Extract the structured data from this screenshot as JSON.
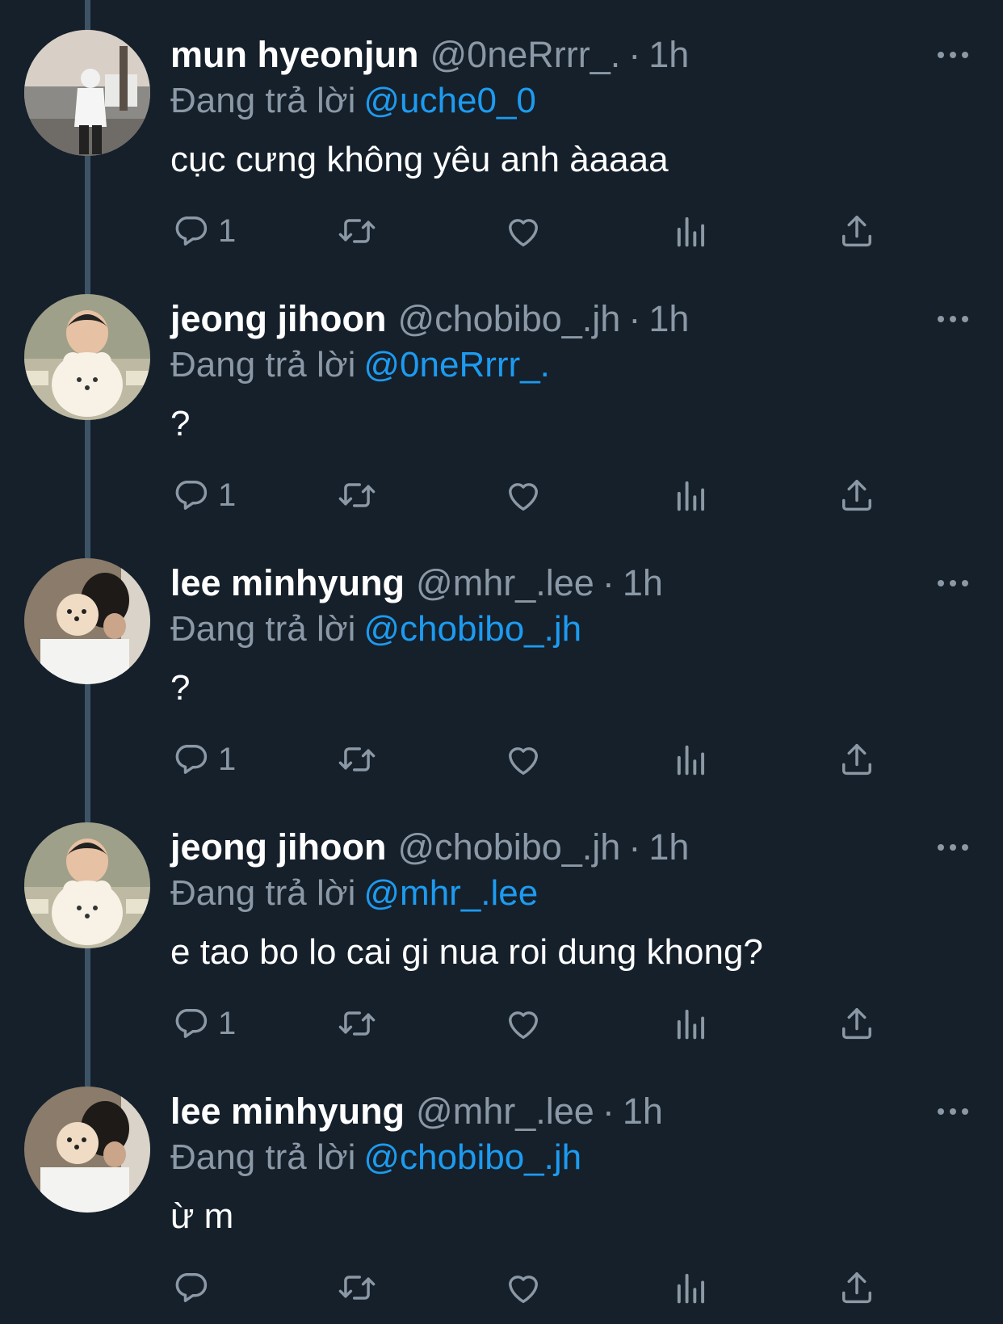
{
  "colors": {
    "background": "#15202b",
    "primary_text": "#ffffff",
    "secondary_text": "#8b98a5",
    "link": "#1d9bf0",
    "thread_line": "#3d5466"
  },
  "icons": {
    "reply": "reply-icon",
    "retweet": "retweet-icon",
    "like": "like-icon",
    "views": "views-icon",
    "share": "share-icon",
    "more": "more-icon"
  },
  "reply_prefix": "Đang trả lời",
  "tweets": [
    {
      "name": "mun hyeonjun",
      "handle": "@0neRrrr_.",
      "time": "1h",
      "reply_to": "@uche0_0",
      "text": "cục cưng không yêu anh àaaaa",
      "reply_count": "1"
    },
    {
      "name": "jeong jihoon",
      "handle": "@chobibo_.jh",
      "time": "1h",
      "reply_to": "@0neRrrr_.",
      "text": "?",
      "reply_count": "1"
    },
    {
      "name": "lee minhyung",
      "handle": "@mhr_.lee",
      "time": "1h",
      "reply_to": "@chobibo_.jh",
      "text": "?",
      "reply_count": "1"
    },
    {
      "name": "jeong jihoon",
      "handle": "@chobibo_.jh",
      "time": "1h",
      "reply_to": "@mhr_.lee",
      "text": "e tao bo lo cai gi nua roi dung khong?",
      "reply_count": "1"
    },
    {
      "name": "lee minhyung",
      "handle": "@mhr_.lee",
      "time": "1h",
      "reply_to": "@chobibo_.jh",
      "text": "ừ m",
      "reply_count": ""
    }
  ]
}
